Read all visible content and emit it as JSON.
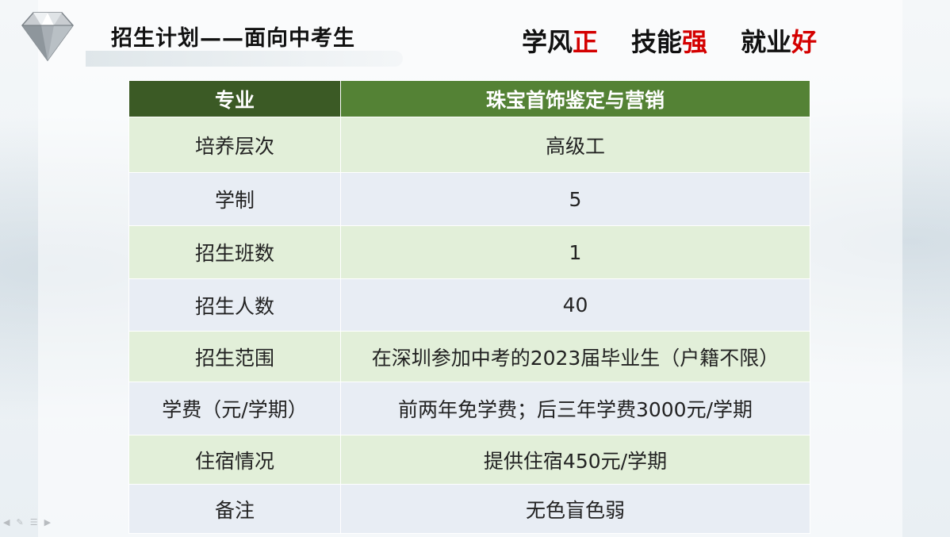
{
  "header": {
    "title": "招生计划——面向中考生",
    "slogans": [
      {
        "text": "学风",
        "highlight": "正"
      },
      {
        "text": "技能",
        "highlight": "强"
      },
      {
        "text": "就业",
        "highlight": "好"
      }
    ],
    "logo_icon": "diamond-icon"
  },
  "table": {
    "header": {
      "col1": "专业",
      "col2": "珠宝首饰鉴定与营销"
    },
    "rows": [
      {
        "label": "培养层次",
        "value": "高级工"
      },
      {
        "label": "学制",
        "value": "5"
      },
      {
        "label": "招生班数",
        "value": "1"
      },
      {
        "label": "招生人数",
        "value": "40"
      },
      {
        "label": "招生范围",
        "value": "在深圳参加中考的2023届毕业生（户籍不限）"
      },
      {
        "label": "学费（元/学期）",
        "value": "前两年免学费；后三年学费3000元/学期"
      },
      {
        "label": "住宿情况",
        "value": "提供住宿450元/学期"
      },
      {
        "label": "备注",
        "value": "无色盲色弱"
      }
    ]
  },
  "colors": {
    "header_dark": "#3b5a25",
    "header_green": "#548235",
    "row_green": "#e2efd9",
    "row_blue": "#e8edf4",
    "accent_red": "#d40000"
  },
  "slideshow_controls": [
    "prev-icon",
    "pen-icon",
    "menu-icon",
    "next-icon"
  ]
}
